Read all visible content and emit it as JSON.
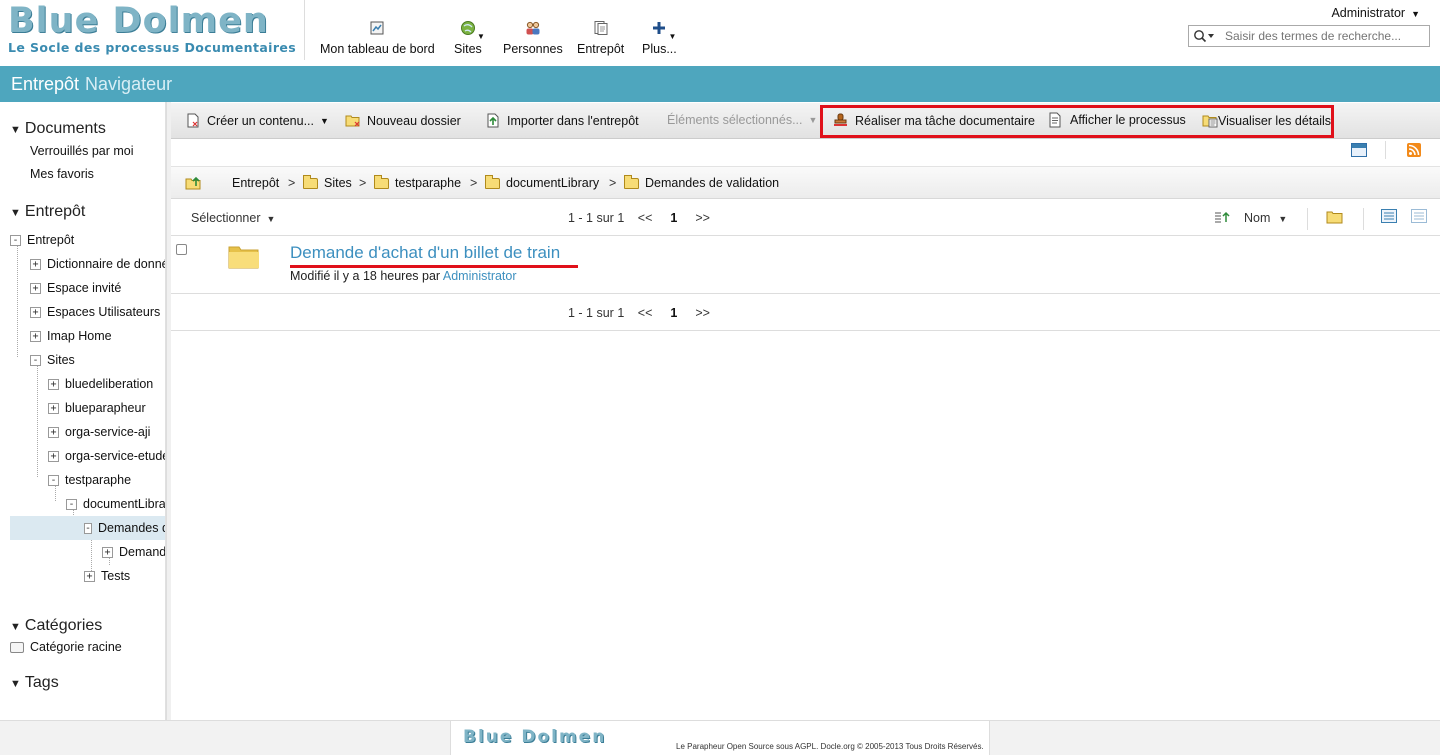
{
  "header": {
    "logo_title": "Blue Dolmen",
    "logo_subtitle": "Le Socle des processus Documentaires",
    "nav": [
      {
        "label": "Mon tableau de bord",
        "icon": "dashboard-icon"
      },
      {
        "label": "Sites",
        "icon": "globe-icon"
      },
      {
        "label": "Personnes",
        "icon": "people-icon"
      },
      {
        "label": "Entrepôt",
        "icon": "repository-icon"
      },
      {
        "label": "Plus...",
        "icon": "plus-icon"
      }
    ],
    "user": "Administrator",
    "search_placeholder": "Saisir des termes de recherche..."
  },
  "titlebar": {
    "part1": "Entrepôt",
    "part2": "Navigateur"
  },
  "left": {
    "documents_title": "Documents",
    "documents_links": [
      "Verrouillés par moi",
      "Mes favoris"
    ],
    "repo_title": "Entrepôt",
    "tree": [
      {
        "label": "Entrepôt",
        "state": "-"
      },
      {
        "label": "Dictionnaire de données",
        "state": "+"
      },
      {
        "label": "Espace invité",
        "state": "+"
      },
      {
        "label": "Espaces Utilisateurs",
        "state": "+"
      },
      {
        "label": "Imap Home",
        "state": "+"
      },
      {
        "label": "Sites",
        "state": "-"
      },
      {
        "label": "bluedeliberation",
        "state": "+"
      },
      {
        "label": "blueparapheur",
        "state": "+"
      },
      {
        "label": "orga-service-aji",
        "state": "+"
      },
      {
        "label": "orga-service-etudes",
        "state": "+"
      },
      {
        "label": "testparaphe",
        "state": "-"
      },
      {
        "label": "documentLibrary",
        "state": "-"
      },
      {
        "label": "Demandes de validation",
        "state": "-"
      },
      {
        "label": "Demande d'achat d'un billet de train",
        "state": "+"
      },
      {
        "label": "Tests",
        "state": "+"
      }
    ],
    "categories_title": "Catégories",
    "category_root": "Catégorie racine",
    "tags_title": "Tags"
  },
  "toolbar": {
    "create": "Créer un contenu...",
    "new_folder": "Nouveau dossier",
    "import": "Importer dans l'entrepôt",
    "selected": "Éléments sélectionnés...",
    "do_task": "Réaliser ma tâche documentaire",
    "show_process": "Afficher le processus",
    "view_details": "Visualiser les détails",
    "highlight_color": "#e0101a"
  },
  "breadcrumb": [
    "Entrepôt",
    "Sites",
    "testparaphe",
    "documentLibrary",
    "Demandes de validation"
  ],
  "list": {
    "select_label": "Sélectionner",
    "pagination_text": "1 - 1 sur 1",
    "prev": "<<",
    "page": "1",
    "next": ">>",
    "sort_label": "Nom",
    "items": [
      {
        "title": "Demande d'achat d'un billet de train",
        "modified_prefix": "Modifié il y a 18 heures par",
        "modified_by": "Administrator"
      }
    ]
  },
  "footer": {
    "logo": "Blue Dolmen",
    "text": "Le Parapheur Open Source sous AGPL. Docle.org © 2005-2013 Tous Droits Réservés."
  }
}
